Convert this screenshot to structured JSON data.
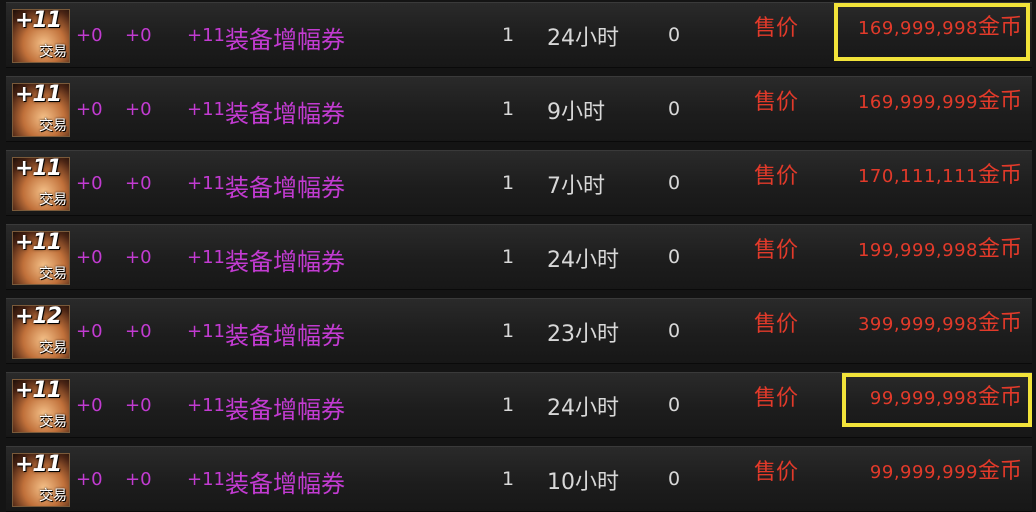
{
  "auction": {
    "sell_label": "售价",
    "currency": "金币",
    "icon_name": "amplification-ticket-icon",
    "trade_tag": "交易",
    "highlight_color": "#f2e33a",
    "price_color": "#e23a2a",
    "name_color": "#c23bd1",
    "listings": [
      {
        "icon_level": "+11",
        "stat1": "+0",
        "stat2": "+0",
        "stat3": "+11",
        "name": "装备增幅券",
        "quantity": "1",
        "time_left": "24小时",
        "bid_count": "0",
        "price": "169,999,998",
        "highlighted": true
      },
      {
        "icon_level": "+11",
        "stat1": "+0",
        "stat2": "+0",
        "stat3": "+11",
        "name": "装备增幅券",
        "quantity": "1",
        "time_left": "9小时",
        "bid_count": "0",
        "price": "169,999,999",
        "highlighted": false
      },
      {
        "icon_level": "+11",
        "stat1": "+0",
        "stat2": "+0",
        "stat3": "+11",
        "name": "装备增幅券",
        "quantity": "1",
        "time_left": "7小时",
        "bid_count": "0",
        "price": "170,111,111",
        "highlighted": false
      },
      {
        "icon_level": "+11",
        "stat1": "+0",
        "stat2": "+0",
        "stat3": "+11",
        "name": "装备增幅券",
        "quantity": "1",
        "time_left": "24小时",
        "bid_count": "0",
        "price": "199,999,998",
        "highlighted": false
      },
      {
        "icon_level": "+12",
        "stat1": "+0",
        "stat2": "+0",
        "stat3": "+11",
        "name": "装备增幅券",
        "quantity": "1",
        "time_left": "23小时",
        "bid_count": "0",
        "price": "399,999,998",
        "highlighted": false
      },
      {
        "icon_level": "+11",
        "stat1": "+0",
        "stat2": "+0",
        "stat3": "+11",
        "name": "装备增幅券",
        "quantity": "1",
        "time_left": "24小时",
        "bid_count": "0",
        "price": "99,999,998",
        "highlighted": true
      },
      {
        "icon_level": "+11",
        "stat1": "+0",
        "stat2": "+0",
        "stat3": "+11",
        "name": "装备增幅券",
        "quantity": "1",
        "time_left": "10小时",
        "bid_count": "0",
        "price": "99,999,999",
        "highlighted": false
      }
    ]
  }
}
